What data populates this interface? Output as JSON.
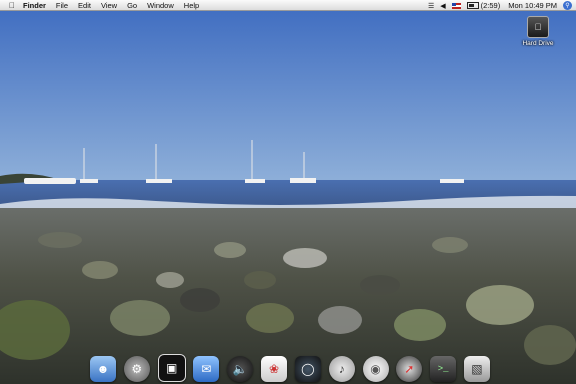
{
  "menubar": {
    "apple": "",
    "items": [
      "Finder",
      "File",
      "Edit",
      "View",
      "Go",
      "Window",
      "Help"
    ],
    "battery_text": "(2:59)",
    "clock": "Mon 10:49 PM"
  },
  "desktop": {
    "icons": [
      {
        "label": "Hard Drive",
        "icon": "hard-drive-icon"
      }
    ]
  },
  "dock": {
    "items": [
      {
        "icon": "finder-icon"
      },
      {
        "icon": "system-preferences-icon"
      },
      {
        "icon": "preview-icon"
      },
      {
        "icon": "mail-icon"
      },
      {
        "icon": "speaker-icon"
      },
      {
        "icon": "photos-icon"
      },
      {
        "icon": "dashboard-icon"
      },
      {
        "icon": "itunes-icon"
      },
      {
        "icon": "cd-icon"
      },
      {
        "icon": "safari-icon"
      },
      {
        "icon": "terminal-icon"
      },
      {
        "icon": "disk-utility-icon"
      }
    ]
  }
}
